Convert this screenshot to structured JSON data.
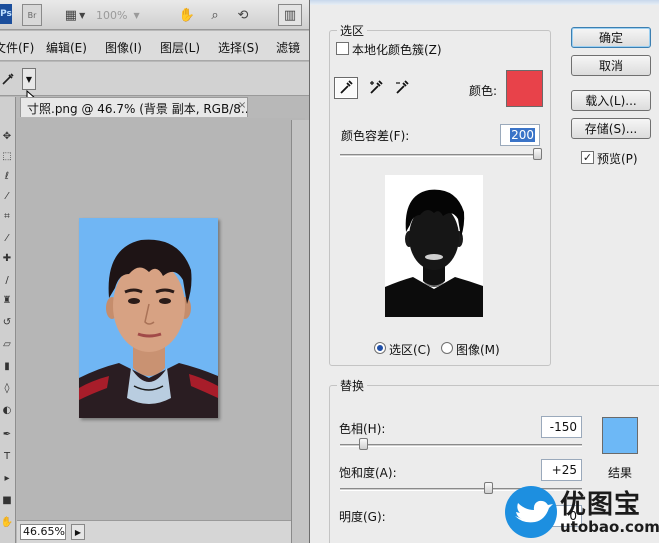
{
  "photoshop": {
    "logo": "Ps",
    "bridge_button": "Br",
    "zoom_select": "100%",
    "menu": [
      "文件(F)",
      "编辑(E)",
      "图像(I)",
      "图层(L)",
      "选择(S)",
      "滤镜"
    ],
    "document_tab": "寸照.png @ 46.7% (背景 副本, RGB/8...",
    "document_tab_close": "×",
    "status_zoom": "46.65%",
    "icons": [
      "hand-icon",
      "zoom-icon",
      "rotate-icon",
      "eyedropper-icon"
    ]
  },
  "dialog": {
    "selection_group": "选区",
    "localized_color_clusters": "本地化颜色簇(Z)",
    "color_label": "颜色:",
    "selected_color": "#e8424a",
    "fuzziness_label": "颜色容差(F):",
    "fuzziness_value": "200",
    "fuzziness_fraction": 1.0,
    "view_selection": "选区(C)",
    "view_image": "图像(M)",
    "replacement_group": "替换",
    "hue_label": "色相(H):",
    "hue_value": "-150",
    "hue_fraction": 0.08,
    "saturation_label": "饱和度(A):",
    "saturation_value": "+25",
    "saturation_fraction": 0.62,
    "lightness_label": "明度(G):",
    "lightness_value": "0",
    "result_label": "结果",
    "result_color": "#6db8f6",
    "buttons": {
      "ok": "确定",
      "cancel": "取消",
      "load": "载入(L)...",
      "save": "存储(S)...",
      "preview": "预览(P)"
    },
    "preview_checked": true
  },
  "watermark": {
    "title": "优图宝",
    "url": "utobao.com"
  }
}
